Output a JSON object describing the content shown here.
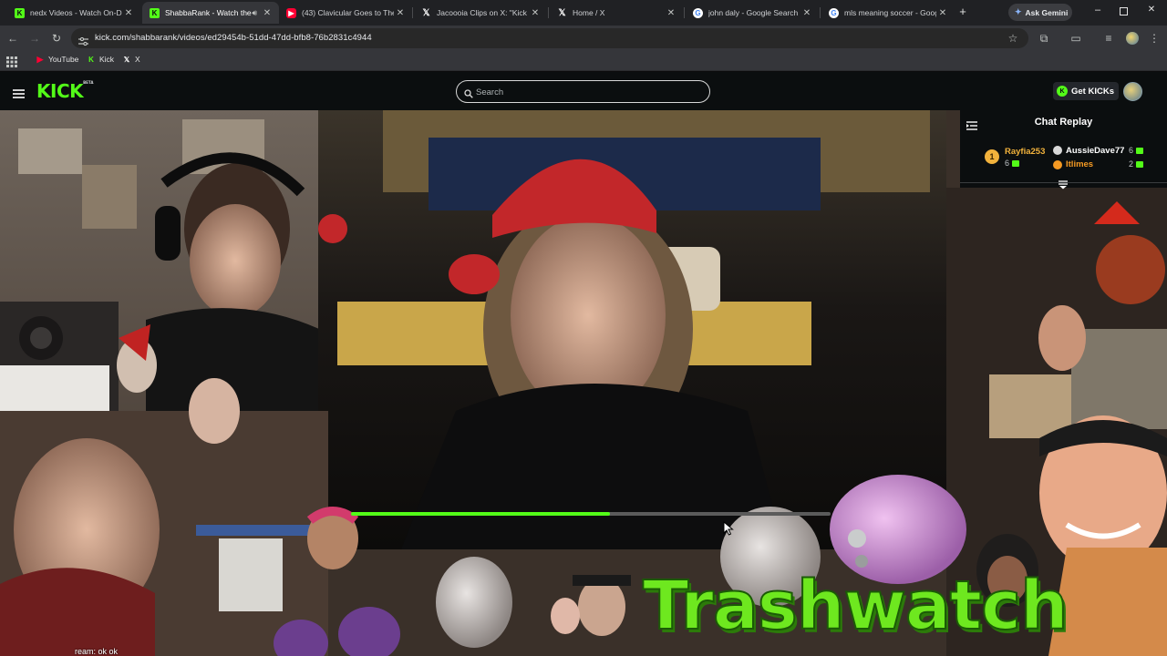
{
  "browser": {
    "tabs": [
      {
        "title": "nedx Videos - Watch On-De",
        "icon": "kick-icon",
        "active": false
      },
      {
        "title": "ShabbaRank - Watch the",
        "icon": "kick-icon",
        "active": true
      },
      {
        "title": "(43) Clavicular Goes to The E",
        "icon": "youtube-icon",
        "active": false
      },
      {
        "title": "Jacoooia Clips on X: \"Kick st",
        "icon": "x-icon",
        "active": false
      },
      {
        "title": "Home / X",
        "icon": "x-icon",
        "active": false
      },
      {
        "title": "john daly - Google Search",
        "icon": "google-icon",
        "active": false
      },
      {
        "title": "mls meaning soccer - Goog",
        "icon": "google-icon",
        "active": false
      }
    ],
    "ask_gemini": "Ask Gemini",
    "url": "kick.com/shabbarank/videos/ed29454b-51dd-47dd-bfb8-76b2831c4944",
    "bookmarks": [
      {
        "label": "YouTube",
        "icon": "youtube-icon"
      },
      {
        "label": "Kick",
        "icon": "kick-icon"
      },
      {
        "label": "X",
        "icon": "x-icon"
      }
    ]
  },
  "kick": {
    "logo": "KICK",
    "logo_badge": "BETA",
    "search_placeholder": "Search",
    "get_kicks": "Get KICKs"
  },
  "chat": {
    "title": "Chat Replay",
    "gifters": [
      {
        "rank": "1",
        "name": "Rayfia253",
        "count": "6",
        "color": "#f2b23c"
      },
      {
        "name": "AussieDave77",
        "count": "6",
        "color": "#ffffff"
      },
      {
        "name": "Itlimes",
        "count": "2",
        "color": "#f59a23"
      }
    ]
  },
  "video": {
    "progress": 0.54,
    "caption": "ream: ok ok",
    "overlay_text": "Trashwatch",
    "accent": "#53fc18"
  }
}
